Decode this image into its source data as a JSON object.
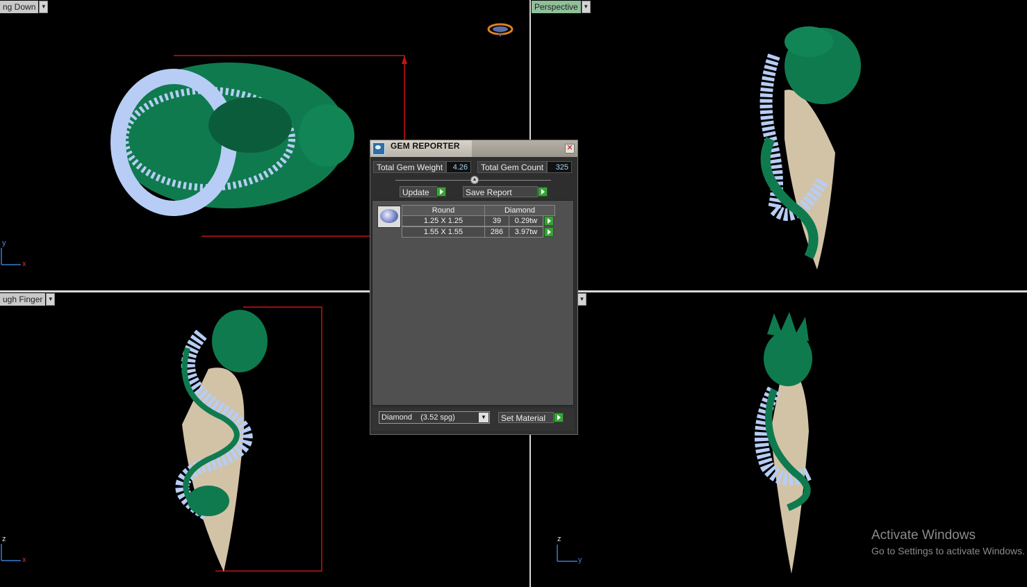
{
  "viewports": {
    "top_left_label": "ng Down",
    "top_right_label": "Perspective",
    "bottom_left_label": "ugh Finger",
    "top_left_axes": {
      "a": "y",
      "b": "x"
    },
    "bottom_left_axes": {
      "a": "z",
      "b": "x"
    },
    "bottom_right_axes": {
      "a": "z",
      "b": "y"
    }
  },
  "gem_reporter": {
    "title": "GEM REPORTER",
    "total_weight_label": "Total Gem Weight",
    "total_weight_value": "4.26",
    "total_count_label": "Total Gem Count",
    "total_count_value": "325",
    "update_label": "Update",
    "save_report_label": "Save Report",
    "table": {
      "shape": "Round",
      "material": "Diamond",
      "rows": [
        {
          "size": "1.25 X 1.25",
          "count": "39",
          "weight": "0.29tw"
        },
        {
          "size": "1.55 X 1.55",
          "count": "286",
          "weight": "3.97tw"
        }
      ]
    },
    "material_select": "Diamond    (3.52 spg)",
    "set_material_label": "Set Material"
  },
  "watermark": {
    "title": "Activate Windows",
    "subtitle": "Go to Settings to activate Windows."
  },
  "colors": {
    "dragon_green": "#0f7a4e",
    "scales_blue": "#b7cdf5",
    "horn_cream": "#d2c3a7",
    "dimension_red": "#c81414",
    "active_tab": "#8fc09a"
  }
}
